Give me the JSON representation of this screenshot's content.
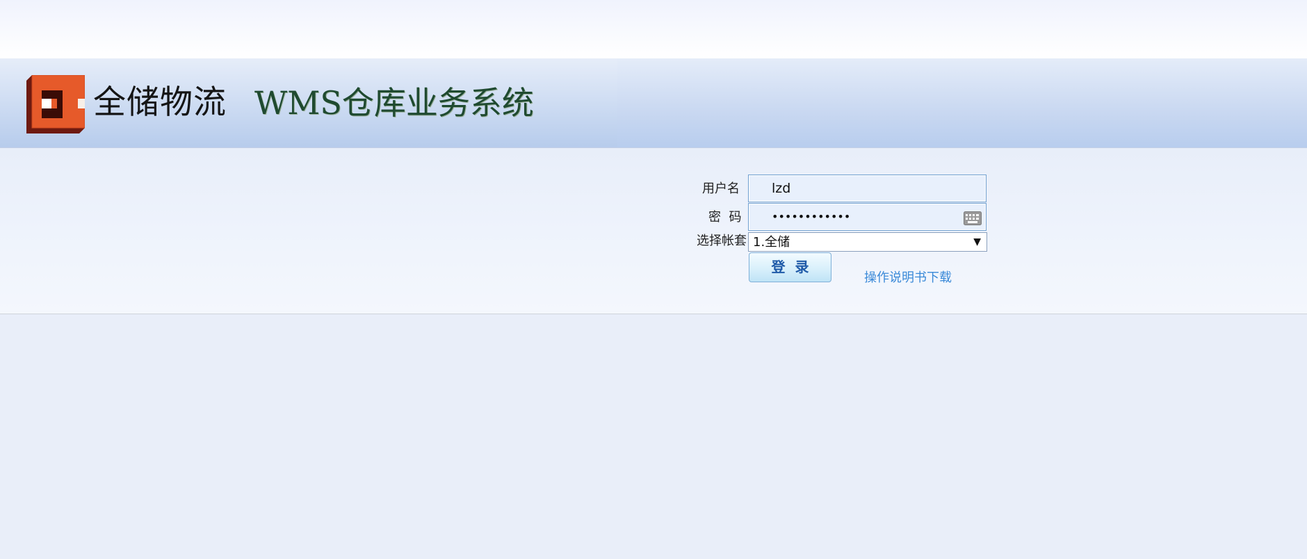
{
  "header": {
    "company_name": "全储物流",
    "system_title": "WMS仓库业务系统"
  },
  "login_form": {
    "username_label": "用户名",
    "username_value": "lzd",
    "password_label": "密  码",
    "password_value": "••••••••••••",
    "account_set_label": "选择帐套",
    "account_set_selected": "1.全储",
    "login_button_label": "登录",
    "manual_link_text": "操作说明书下载"
  },
  "icons": {
    "logo": "company-logo-icon",
    "keyboard": "keyboard-icon",
    "dropdown": "dropdown-arrow-icon"
  },
  "colors": {
    "logo_orange": "#e65a2a",
    "logo_dark": "#7a1e12",
    "title_green": "#1f4a30",
    "link_blue": "#3b8ad8",
    "button_text": "#1e5aa8"
  }
}
